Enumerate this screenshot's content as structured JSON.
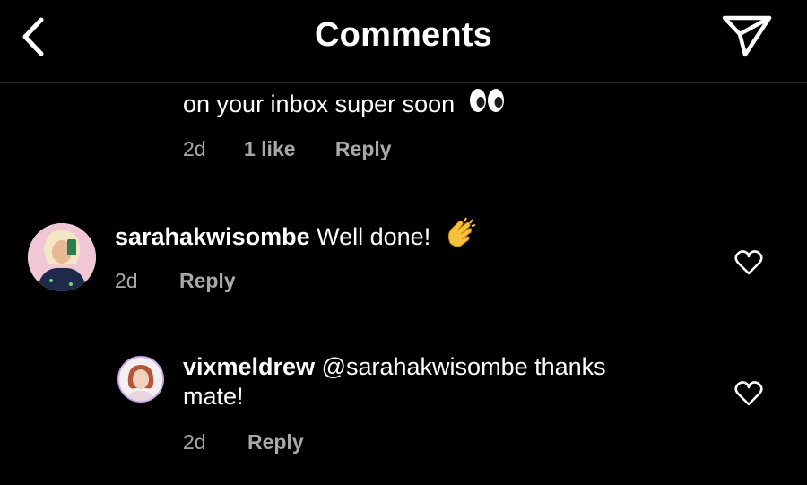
{
  "header": {
    "title": "Comments",
    "back_icon": "chevron-left-icon",
    "share_icon": "paper-plane-icon"
  },
  "comments": [
    {
      "text_visible": "on your inbox super soon",
      "emoji": "eyes-emoji",
      "time": "2d",
      "likes": "1 like",
      "reply": "Reply"
    },
    {
      "username": "sarahakwisombe",
      "text": "Well done!",
      "emoji": "clapping-hands-emoji",
      "time": "2d",
      "reply": "Reply"
    },
    {
      "username": "vixmeldrew",
      "mention": "@sarahakwisombe",
      "text_line1": "thanks",
      "text_line2": "mate!",
      "time": "2d",
      "reply": "Reply"
    }
  ],
  "colors": {
    "background": "#000000",
    "text": "#ffffff",
    "meta": "#a8a8a8",
    "avatar_ring": "#c9a7e8"
  }
}
